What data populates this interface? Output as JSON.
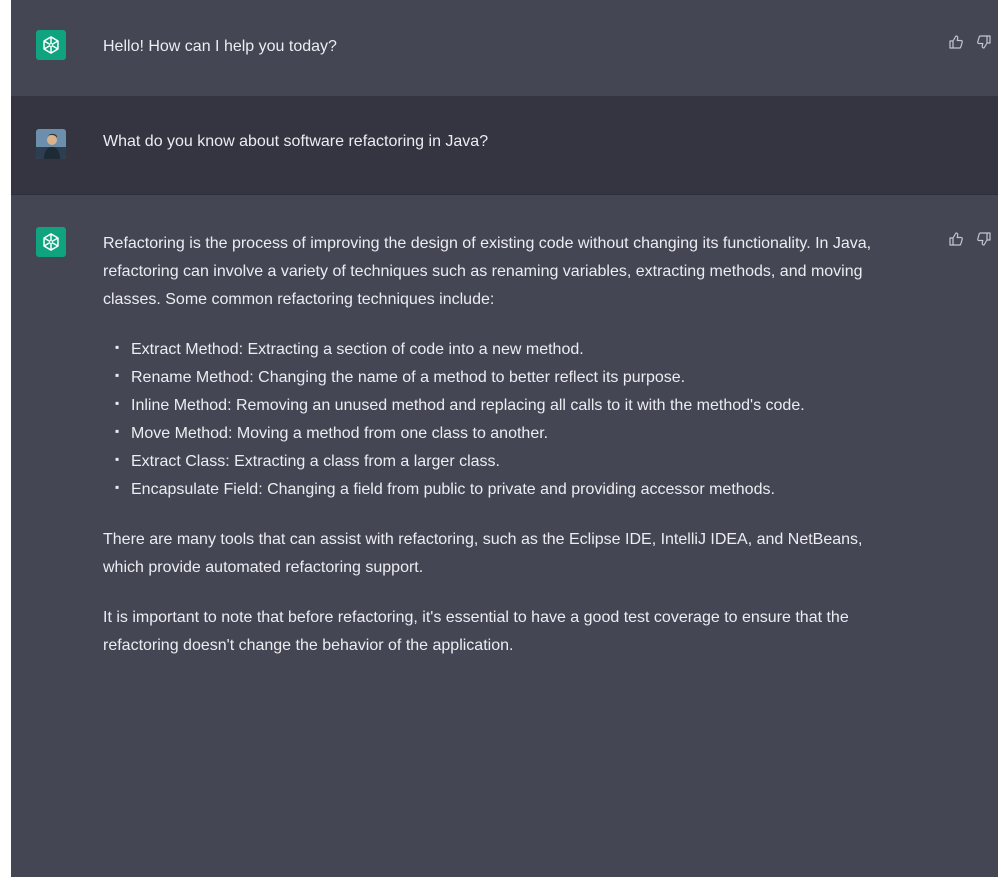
{
  "messages": {
    "greeting": {
      "role": "assistant",
      "text": "Hello! How can I help you today?"
    },
    "question": {
      "role": "user",
      "text": "What do you know about software refactoring in Java?"
    },
    "answer": {
      "role": "assistant",
      "intro": "Refactoring is the process of improving the design of existing code without changing its functionality. In Java, refactoring can involve a variety of techniques such as renaming variables, extracting methods, and moving classes. Some common refactoring techniques include:",
      "techniques": [
        "Extract Method: Extracting a section of code into a new method.",
        "Rename Method: Changing the name of a method to better reflect its purpose.",
        "Inline Method: Removing an unused method and replacing all calls to it with the method's code.",
        "Move Method: Moving a method from one class to another.",
        "Extract Class: Extracting a class from a larger class.",
        "Encapsulate Field: Changing a field from public to private and providing accessor methods."
      ],
      "tools": "There are many tools that can assist with refactoring, such as the Eclipse IDE, IntelliJ IDEA, and NetBeans, which provide automated refactoring support.",
      "note": "It is important to note that before refactoring, it's essential to have a good test coverage to ensure that the refactoring doesn't change the behavior of the application."
    }
  },
  "icons": {
    "assistant_avatar": "openai-logo-icon",
    "user_avatar": "user-photo",
    "like": "thumbs-up-icon",
    "dislike": "thumbs-down-icon"
  },
  "colors": {
    "assistant_bg": "#444654",
    "user_bg": "#343541",
    "gpt_avatar": "#10a37f",
    "text": "#ececf1",
    "icon": "#c5c5d2"
  }
}
